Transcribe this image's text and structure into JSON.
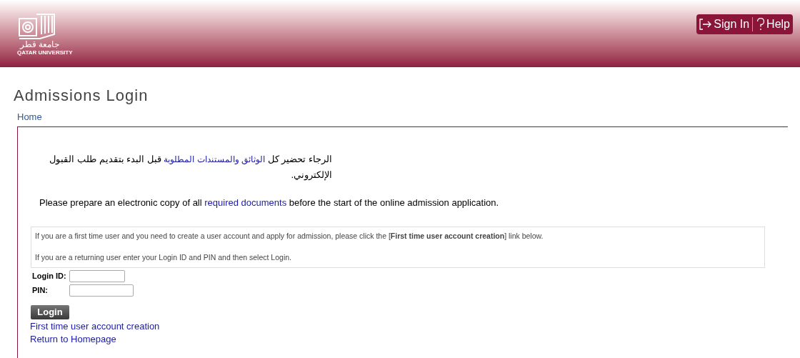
{
  "header": {
    "logo_arabic": "جامعة قطر",
    "logo_english": "QATAR UNIVERSITY",
    "sign_in": "Sign In",
    "help": "Help"
  },
  "title": "Admissions Login",
  "breadcrumb": "Home",
  "arabic_notice": {
    "before": "الرجاء تحضير كل ",
    "link": "الوثائق والمستندات المطلوبة",
    "after": " قبل البدء بتقديم طلب القبول الإلكتروني."
  },
  "english_notice": {
    "before": "Please prepare an electronic copy of all ",
    "link": "required documents",
    "after": " before the start of the online admission application."
  },
  "info": [
    "If you are a first time user and you need to create a user account and apply for admission, please click the [**First time user account creation**] link below.",
    "If you are a returning user enter your Login ID and PIN and then select Login."
  ],
  "form": {
    "fields": [
      {
        "label": "Login ID:"
      },
      {
        "label": "PIN:"
      }
    ],
    "submit": "Login"
  },
  "links": [
    "First time user account creation",
    "Return to Homepage"
  ]
}
